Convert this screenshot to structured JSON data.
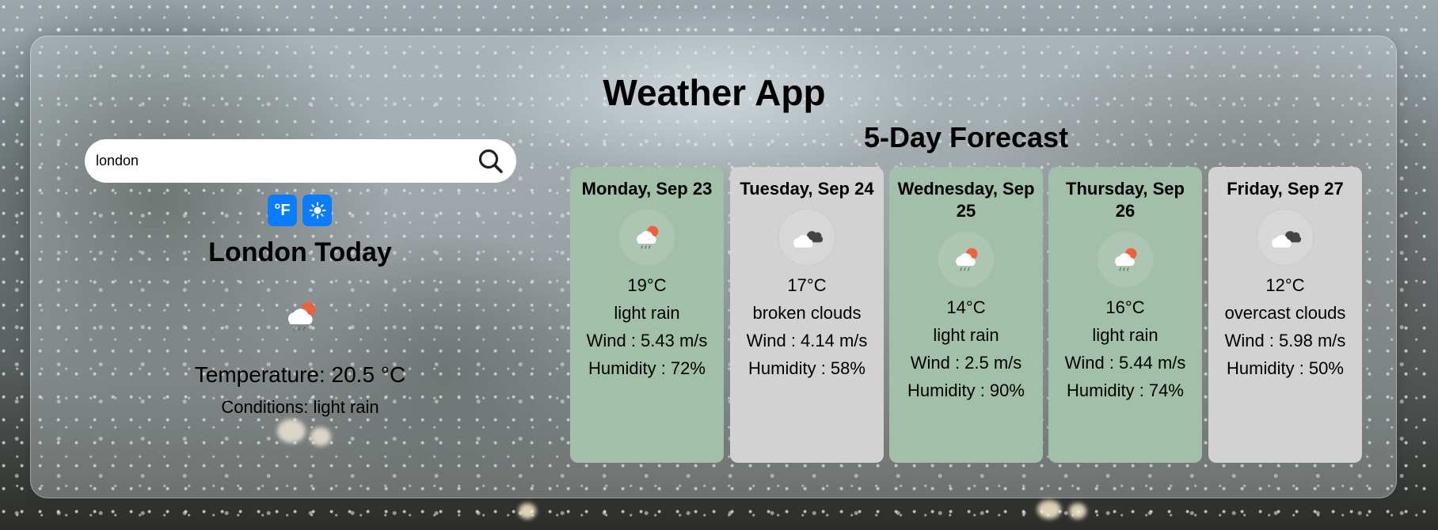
{
  "app": {
    "title": "Weather App"
  },
  "search": {
    "value": "london",
    "placeholder": ""
  },
  "units": {
    "fahrenheit_label": "°F",
    "theme_icon": "sun-icon"
  },
  "today": {
    "title": "London Today",
    "icon": "rain-cloud-sun-icon",
    "temperature": "Temperature: 20.5 °C",
    "conditions": "Conditions: light rain"
  },
  "forecast": {
    "title": "5-Day Forecast",
    "days": [
      {
        "date": "Monday, Sep 23",
        "icon": "rain-cloud-sun-icon",
        "temp": "19°C",
        "desc": "light rain",
        "wind": "Wind : 5.43 m/s",
        "humidity": "Humidity : 72%",
        "color": "#a1bfa9"
      },
      {
        "date": "Tuesday, Sep 24",
        "icon": "broken-clouds-icon",
        "temp": "17°C",
        "desc": "broken clouds",
        "wind": "Wind : 4.14 m/s",
        "humidity": "Humidity : 58%",
        "color": "#d2d2d2"
      },
      {
        "date": "Wednesday, Sep 25",
        "icon": "rain-cloud-sun-icon",
        "temp": "14°C",
        "desc": "light rain",
        "wind": "Wind : 2.5 m/s",
        "humidity": "Humidity : 90%",
        "color": "#a1bfa9"
      },
      {
        "date": "Thursday, Sep 26",
        "icon": "rain-cloud-sun-icon",
        "temp": "16°C",
        "desc": "light rain",
        "wind": "Wind : 5.44 m/s",
        "humidity": "Humidity : 74%",
        "color": "#a1bfa9"
      },
      {
        "date": "Friday, Sep 27",
        "icon": "overcast-clouds-icon",
        "temp": "12°C",
        "desc": "overcast clouds",
        "wind": "Wind : 5.98 m/s",
        "humidity": "Humidity : 50%",
        "color": "#d2d2d2"
      }
    ]
  },
  "colors": {
    "accent": "#0a7cff",
    "rain_card": "#a1bfa9",
    "cloud_card": "#d2d2d2"
  }
}
